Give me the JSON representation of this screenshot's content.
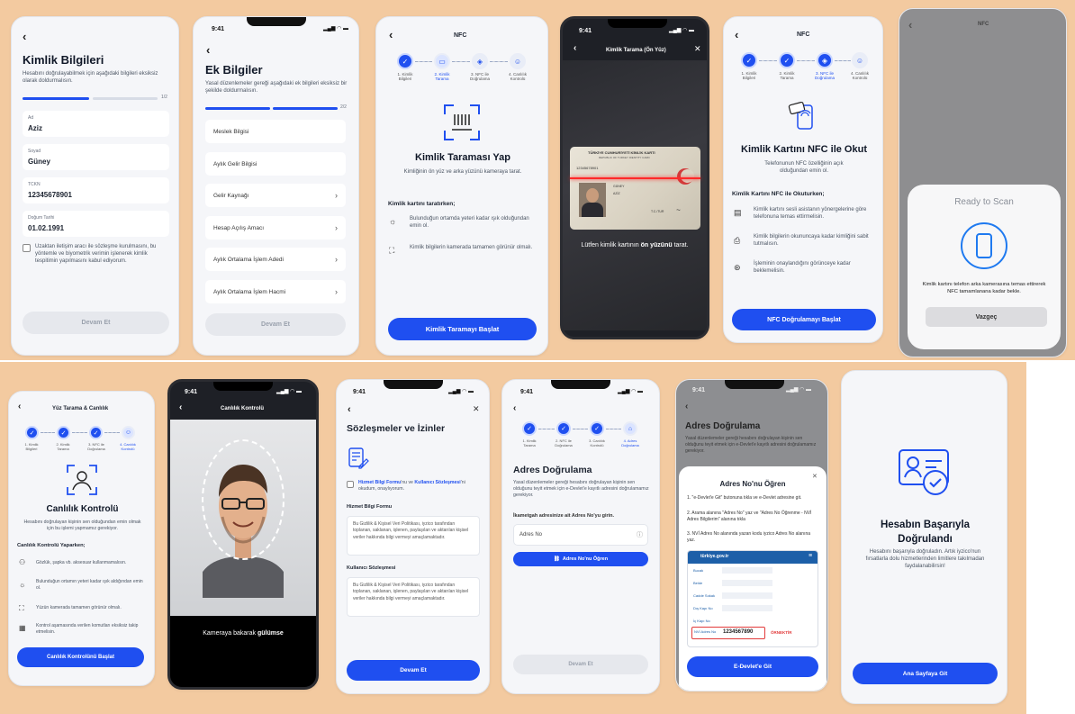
{
  "s1": {
    "title": "Kimlik Bilgileri",
    "desc": "Hesabını doğrulayabilmek için aşağıdaki bilgileri eksiksiz olarak doldurmalısın.",
    "progress": "1/2",
    "progress_value": 0.5,
    "fields": [
      {
        "label": "Ad",
        "value": "Aziz"
      },
      {
        "label": "Soyad",
        "value": "Güney"
      },
      {
        "label": "TCKN",
        "value": "12345678901"
      },
      {
        "label": "Doğum Tarihi",
        "value": "01.02.1991"
      }
    ],
    "consent": "Uzaktan iletişim aracı ile sözleşme kurulmasını, bu yöntemle ve biyometrik verimin işlenerek kimlik tespitimin yapılmasını kabul ediyorum.",
    "button": "Devam Et"
  },
  "s2": {
    "time": "9:41",
    "title": "Ek Bilgiler",
    "desc": "Yasal düzenlemeler gereği aşağıdaki ek bilgileri eksiksiz bir şekilde doldurmalısın.",
    "progress": "2/2",
    "items": [
      "Meslek Bilgisi",
      "Aylık Gelir Bilgisi",
      "Gelir Kaynağı",
      "Hesap Açılış Amacı",
      "Aylık Ortalama İşlem Adedi",
      "Aylık Ortalama İşlem Hacmi"
    ],
    "button": "Devam Et"
  },
  "s3": {
    "header": "NFC",
    "steps": [
      "1. Kimlik Bilgileri",
      "2. Kimlik Tarama",
      "3. NFC ile Doğrulama",
      "4. Canlılık Kontrolü"
    ],
    "title": "Kimlik Taraması Yap",
    "desc": "Kimliğinin ön yüz ve arka yüzünü kameraya tarat.",
    "section": "Kimlik kartını taratırken;",
    "tips": [
      "Bulunduğun ortamda yeteri kadar ışık olduğundan emin ol.",
      "Kimlik bilgilerin kamerada tamamen görünür olmalı."
    ],
    "button": "Kimlik Taramayı Başlat"
  },
  "s4": {
    "time": "9:41",
    "header": "Kimlik Tarama (Ön Yüz)",
    "card_title": "TÜRKİYE CUMHURİYETİ KİMLİK KARTI",
    "card_sub": "REPUBLIC OF TURKEY IDENTITY CARD",
    "card_no": "12345678901",
    "card_name": "GÜNEY",
    "card_given": "AZİZ",
    "card_nat": "T.C./TUR",
    "caption_pre": "Lütfen kimlik kartının",
    "caption_bold": "ön yüzünü",
    "caption_post": "tarat."
  },
  "s5": {
    "header": "NFC",
    "steps": [
      "1. Kimlik Bilgileri",
      "2. Kimlik Tarama",
      "3. NFC ile Doğrulama",
      "4. Canlılık Kontrolü"
    ],
    "title": "Kimlik Kartını NFC ile Okut",
    "desc": "Telefonunun NFC özelliğinin açık olduğundan emin ol.",
    "section": "Kimlik Kartını NFC ile Okuturken;",
    "tips": [
      "Kimlik kartını sesli asistanın yönergelerine göre telefonuna temas ettirmelisin.",
      "Kimlik bilgilerin okununcaya kadar kimliğini sabit tutmalısın.",
      "İşleminin onaylandığını görünceye kadar beklemelisin."
    ],
    "button": "NFC Doğrulamayı Başlat"
  },
  "s6": {
    "header": "NFC",
    "sheet_title": "Ready to Scan",
    "sheet_desc": "Kimlik kartını telefon arka kamerasına temas ettirerek NFC tamamlanana kadar bekle.",
    "cancel": "Vazgeç"
  },
  "s7": {
    "header": "Yüz Tarama & Canlılık",
    "steps": [
      "1. Kimlik Bilgileri",
      "2. Kimlik Tarama",
      "3. NFC ile Doğrulama",
      "4. Canlılık Kontrolü"
    ],
    "title": "Canlılık Kontrolü",
    "desc": "Hesabını doğrulayan kişinin sen olduğundan emin olmak için bu işlemi yapmamız gerekiyor.",
    "section": "Canlılık Kontrolü Yaparken;",
    "tips": [
      "Gözlük, şapka vb. aksesuar kullanmamalısın.",
      "Bulunduğun ortamın yeteri kadar ışık aldığından emin ol.",
      "Yüzün kamerada tamamen görünür olmalı.",
      "Kontrol aşamasında verilen komutları eksiksiz takip etmelisin."
    ],
    "button": "Canlılık Kontrolünü Başlat"
  },
  "s8": {
    "time": "9:41",
    "header": "Canlılık Kontrolü",
    "caption_pre": "Kameraya bakarak",
    "caption_bold": "gülümse"
  },
  "s9": {
    "time": "9:41",
    "title": "Sözleşmeler ve İzinler",
    "consent_link1": "Hizmet Bilgi Formu",
    "consent_mid": "'nu ve",
    "consent_link2": "Kullanıcı Sözleşmesi",
    "consent_rest": "'ni okudum, onaylıyorum.",
    "doc1_title": "Hizmet Bilgi Formu",
    "doc1_text": "Bu Gizlilik & Kişisel Veri Politikası, iyzico tarafından toplanan, saklanan, işlenen, paylaşılan ve aktarılan kişisel veriler hakkında bilgi vermeyi amaçlamaktadır.",
    "doc2_title": "Kullanıcı Sözleşmesi",
    "doc2_text": "Bu Gizlilik & Kişisel Veri Politikası, iyzico tarafından toplanan, saklanan, işlenen, paylaşılan ve aktarılan kişisel veriler hakkında bilgi vermeyi amaçlamaktadır.",
    "button": "Devam Et"
  },
  "s10": {
    "time": "9:41",
    "steps": [
      "1. Kimlik Tarama",
      "2. NFC ile Doğrulama",
      "3. Canlılık Kontrolü",
      "4. Adres Doğrulama"
    ],
    "title": "Adres Doğrulama",
    "desc": "Yasal düzenlemeler gereği hesabını doğrulayan kişinin sen olduğunu teyit etmek için e-Devlet'e kayıtlı adresini doğrulamamız gerekiyor.",
    "label": "İkametgah adresinize ait Adres No'yu girin.",
    "placeholder": "Adres No",
    "link_button": "Adres No'nu Öğren",
    "button": "Devam Et"
  },
  "s11": {
    "time": "9:41",
    "bg_title": "Adres Doğrulama",
    "bg_desc": "Yasal düzenlemeler gereği hesabını doğrulayan kişinin sen olduğunu teyit etmek için e-Devlet'e kayıtlı adresini doğrulamamız gerekiyor.",
    "sheet_title": "Adres No'nu Öğren",
    "steps": [
      "1. \"e-Devlet'e Git\" butonuna tıkla ve e-Devlet adresine git.",
      "2. Arama alanına \"Adres No\" yaz ve \"Adres No Öğrenme - NVİ Adres Bilgilerim\" alanına tıkla",
      "3. NVİ Adres No alanında yazan kodu iyzico Adres No alanına yaz."
    ],
    "gov_logo": "türkiye.gov.tr",
    "rows": [
      "Bucak",
      "Belde",
      "Cadde Sokak",
      "Dış Kapı No",
      "İç Kapı No"
    ],
    "nvi_label": "NVİ Adres No",
    "nvi_value": "1234567890",
    "nvi_mark": "ÖRNEKTİR",
    "button": "E-Devlet'e Git"
  },
  "s12": {
    "title": "Hesabın Başarıyla Doğrulandı",
    "desc": "Hesabını başarıyla doğruladın. Artık iyzico'nun fırsatlarla dolu hizmetlerinden limitlere takılmadan faydalanabilirsin!",
    "button": "Ana Sayfaya Git"
  }
}
